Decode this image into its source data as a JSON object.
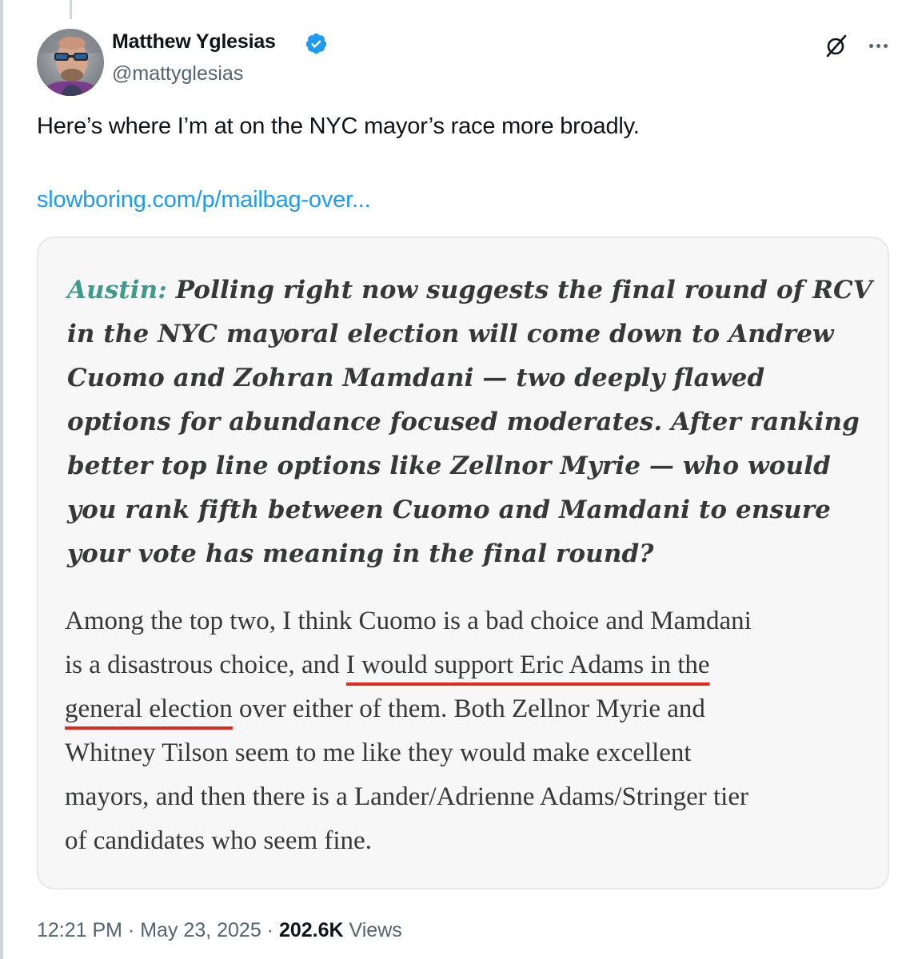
{
  "author": {
    "name": "Matthew Yglesias",
    "handle": "@mattyglesias",
    "verified": true,
    "avatar_icon": "avatar-photo"
  },
  "actions": {
    "grok_icon": "grok-icon",
    "more_icon": "more-options-icon"
  },
  "tweet": {
    "text": "Here’s where I’m at on the NYC mayor’s race more broadly.",
    "link": "slowboring.com/p/mailbag-over..."
  },
  "quote": {
    "asker": "Austin:",
    "question": "Polling right now suggests the final round of RCV in the NYC mayoral election will come down to Andrew Cuomo and Zohran Mamdani — two deeply flawed options for abundance focused moderates. After ranking better top line options like Zellnor Myrie — who would you rank fifth between Cuomo and Mamdani to ensure your vote has meaning in the final round?",
    "answer_lines": {
      "l1": "Among the top two, I think Cuomo is a bad choice and Mamdani",
      "l2_pre": "is a disastrous choice, and ",
      "l2_hl": "I would support Eric Adams in the",
      "l3_hl": "general election",
      "l3_post": " over either of them. Both Zellnor Myrie and",
      "l4": "Whitney Tilson seem to me like they would make excellent",
      "l5": "mayors, and then there is a Lander/Adrienne Adams/Stringer tier",
      "l6": "of candidates who seem fine."
    },
    "highlight_color": "#e02a1e",
    "asker_color": "#3f9a8b"
  },
  "meta": {
    "time": "12:21 PM",
    "sep1": " · ",
    "date": "May 23, 2025",
    "sep2": " · ",
    "views_count": "202.6K",
    "views_label": " Views"
  },
  "colors": {
    "link": "#1d9bf0",
    "secondary": "#536471",
    "card_bg": "#f7f7f7"
  }
}
